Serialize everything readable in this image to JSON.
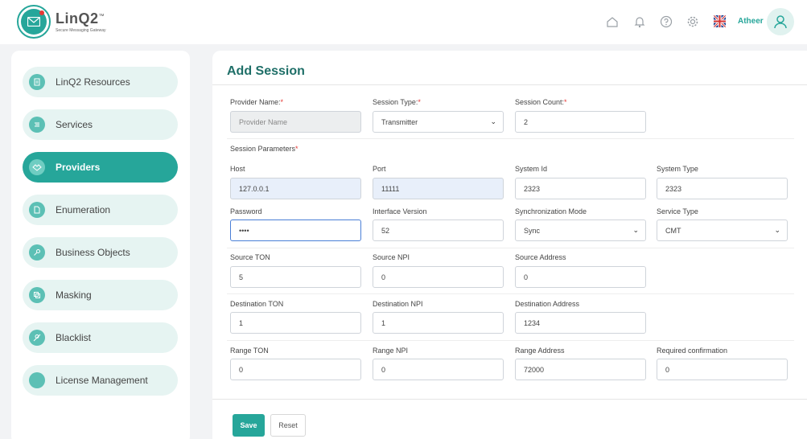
{
  "header": {
    "logo_name": "LinQ2",
    "logo_tm": "™",
    "logo_tagline": "Secure Messaging Gateway",
    "username": "Atheer",
    "icons": [
      "home-icon",
      "bell-icon",
      "help-icon",
      "gear-icon",
      "uk-flag-icon",
      "user-avatar-icon"
    ]
  },
  "colors": {
    "accent": "#26a69a",
    "title": "#1f6f68",
    "nav_bg": "#e6f4f2",
    "required": "#e53935"
  },
  "sidebar": {
    "items": [
      {
        "label": "LinQ2 Resources",
        "icon": "resources-icon"
      },
      {
        "label": "Services",
        "icon": "services-icon"
      },
      {
        "label": "Providers",
        "icon": "handshake-icon",
        "active": true
      },
      {
        "label": "Enumeration",
        "icon": "document-icon"
      },
      {
        "label": "Business Objects",
        "icon": "key-icon"
      },
      {
        "label": "Masking",
        "icon": "copy-icon"
      },
      {
        "label": "Blacklist",
        "icon": "user-block-icon"
      },
      {
        "label": "License Management",
        "icon": "license-icon"
      }
    ]
  },
  "form": {
    "title": "Add Session",
    "required_mark": "*",
    "provider_name": {
      "label": "Provider Name:",
      "placeholder": "Provider Name"
    },
    "session_type": {
      "label": "Session Type:",
      "value": "Transmitter"
    },
    "session_count": {
      "label": "Session Count:",
      "value": "2"
    },
    "session_parameters_label": "Session Parameters",
    "host": {
      "label": "Host",
      "value": "127.0.0.1"
    },
    "port": {
      "label": "Port",
      "value": "11111"
    },
    "system_id": {
      "label": "System Id",
      "value": "2323"
    },
    "system_type": {
      "label": "System Type",
      "value": "2323"
    },
    "password": {
      "label": "Password",
      "value": "••••"
    },
    "interface_version": {
      "label": "Interface Version",
      "value": "52"
    },
    "sync_mode": {
      "label": "Synchronization Mode",
      "value": "Sync"
    },
    "service_type": {
      "label": "Service Type",
      "value": "CMT"
    },
    "source_ton": {
      "label": "Source TON",
      "value": "5"
    },
    "source_npi": {
      "label": "Source NPI",
      "value": "0"
    },
    "source_address": {
      "label": "Source Address",
      "value": "0"
    },
    "dest_ton": {
      "label": "Destination TON",
      "value": "1"
    },
    "dest_npi": {
      "label": "Destination NPI",
      "value": "1"
    },
    "dest_address": {
      "label": "Destination Address",
      "value": "1234"
    },
    "range_ton": {
      "label": "Range TON",
      "value": "0"
    },
    "range_npi": {
      "label": "Range NPI",
      "value": "0"
    },
    "range_address": {
      "label": "Range Address",
      "value": "72000"
    },
    "required_confirmation": {
      "label": "Required confirmation",
      "value": "0"
    },
    "save_label": "Save",
    "reset_label": "Reset"
  }
}
